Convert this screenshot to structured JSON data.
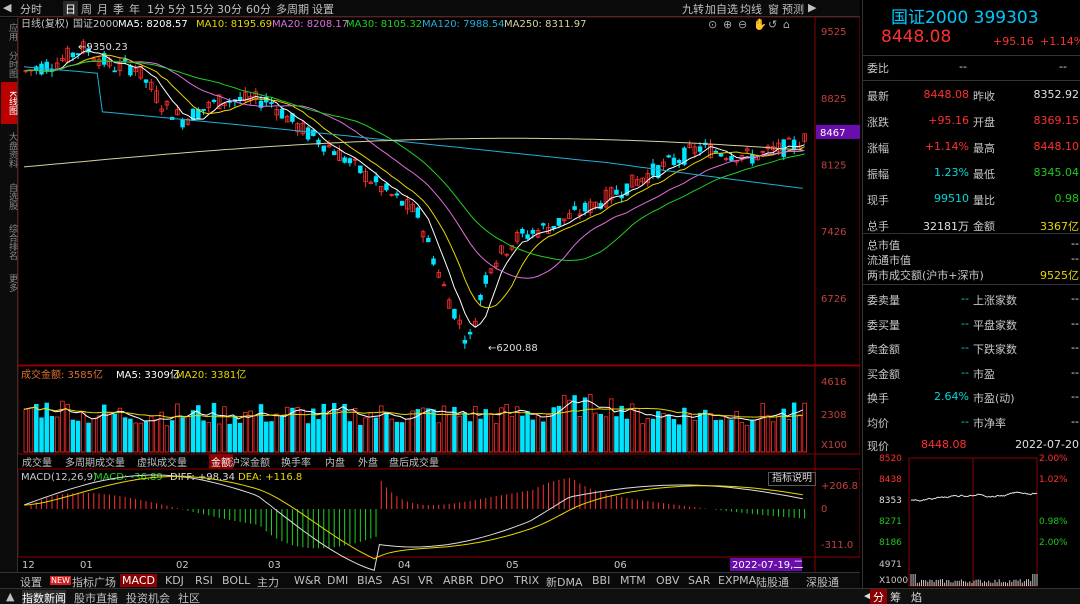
{
  "toolbar": {
    "period_tabs": [
      "分时",
      "日",
      "周",
      "月",
      "季",
      "年",
      "1分",
      "5分",
      "15分",
      "30分",
      "60分",
      "多周期",
      "设置"
    ],
    "right_tools": [
      "九转",
      "加自选",
      "均线",
      "窗",
      "预测"
    ]
  },
  "sidebar": {
    "items": [
      "应用",
      "分时图",
      "K线图",
      "大盘资料",
      "自选股",
      "综合排名",
      "更多"
    ]
  },
  "main_chart": {
    "info_label": "日线(复权)",
    "index_name": "国证2000",
    "ma5": "MA5: 8208.57",
    "ma10": "MA10: 8195.69",
    "ma20": "MA20: 8208.17",
    "ma30": "MA30: 8105.32",
    "ma120": "MA120: 7988.54",
    "ma250": "MA250: 8311.97",
    "high_label": "9350.23",
    "low_label": "6200.88",
    "price_axis": [
      "9525",
      "8825",
      "8125",
      "7426",
      "6726"
    ],
    "last_price_tag": "8467"
  },
  "volume_panel": {
    "label": "成交金额: 3585亿",
    "ma5": "MA5: 3309亿",
    "ma20": "MA20: 3381亿",
    "axis": [
      "4616",
      "2308",
      "X100"
    ]
  },
  "indicator_tabs": [
    "成交量",
    "多周期成交量",
    "虚拟成交量",
    "金额",
    "沪深金额",
    "换手率",
    "内盘",
    "外盘",
    "盘后成交量"
  ],
  "indicator_active": "金额",
  "macd_panel": {
    "label": "MACD(12,26,9)",
    "macd": "MACD: -36.89",
    "diff": "DIFF: +98.34",
    "dea": "DEA: +116.8",
    "axis": [
      "+206.8",
      "0",
      "-311.0"
    ],
    "explain_button": "指标说明"
  },
  "date_axis": [
    "12",
    "01",
    "02",
    "03",
    "04",
    "05",
    "06"
  ],
  "cursor_date": "2022-07-19,二",
  "indicator_bar": [
    "设置",
    "NEW",
    "指标广场",
    "MACD",
    "KDJ",
    "RSI",
    "BOLL",
    "主力",
    "W&R",
    "DMI",
    "BIAS",
    "ASI",
    "VR",
    "ARBR",
    "DPO",
    "TRIX",
    "新DMA",
    "BBI",
    "MTM",
    "OBV",
    "SAR",
    "EXPMA",
    "陆股通",
    "深股通"
  ],
  "status_bar": [
    "指数新闻",
    "股市直播",
    "投资机会",
    "社区"
  ],
  "quote": {
    "name": "国证2000",
    "code": "399303",
    "price": "8448.08",
    "change": "+95.16",
    "change_pct": "+1.14%",
    "weibi_label": "委比",
    "weibi_val": "--",
    "weibi_val2": "--",
    "rows": [
      {
        "l1": "最新",
        "v1": "8448.08",
        "l2": "昨收",
        "v2": "8352.92",
        "c1": "red",
        "c2": "white"
      },
      {
        "l1": "涨跌",
        "v1": "+95.16",
        "l2": "开盘",
        "v2": "8369.15",
        "c1": "red",
        "c2": "red"
      },
      {
        "l1": "涨幅",
        "v1": "+1.14%",
        "l2": "最高",
        "v2": "8448.10",
        "c1": "red",
        "c2": "red"
      },
      {
        "l1": "振幅",
        "v1": "1.23%",
        "l2": "最低",
        "v2": "8345.04",
        "c1": "cyan",
        "c2": "green"
      },
      {
        "l1": "现手",
        "v1": "99510",
        "l2": "量比",
        "v2": "0.98",
        "c1": "cyan",
        "c2": "green"
      },
      {
        "l1": "总手",
        "v1": "32181万",
        "l2": "金额",
        "v2": "3367亿",
        "c1": "white",
        "c2": "yellow"
      }
    ],
    "cap_rows": [
      {
        "l": "总市值",
        "v": "--"
      },
      {
        "l": "流通市值",
        "v": "--"
      },
      {
        "l": "两市成交额(沪市+深市)",
        "v": "9525亿"
      }
    ],
    "breadth_rows": [
      {
        "l1": "委卖量",
        "v1": "--",
        "l2": "上涨家数",
        "v2": "--"
      },
      {
        "l1": "委买量",
        "v1": "--",
        "l2": "平盘家数",
        "v2": "--"
      },
      {
        "l1": "卖金额",
        "v1": "--",
        "l2": "下跌家数",
        "v2": "--"
      },
      {
        "l1": "买金额",
        "v1": "--",
        "l2": "市盈",
        "v2": "--"
      },
      {
        "l1": "换手",
        "v1": "2.64%",
        "l2": "市盈(动)",
        "v2": "--"
      },
      {
        "l1": "均价",
        "v1": "--",
        "l2": "市净率",
        "v2": "--"
      }
    ],
    "partial_row": {
      "l": "现价",
      "v": "8448.08",
      "date": "2022-07-20"
    }
  },
  "intraday": {
    "left_axis": [
      "8520",
      "8438",
      "8353",
      "8271",
      "8186",
      "4971",
      "X1000"
    ],
    "right_axis": [
      "2.00%",
      "1.02%",
      "0.98%",
      "2.00%"
    ]
  },
  "right_tabs": [
    "分",
    "筹",
    "焰"
  ],
  "colors": {
    "up": "#ff3030",
    "down": "#00e5ff",
    "ma5": "#ffffff",
    "ma10": "#e8d600",
    "ma20": "#e070e0",
    "ma30": "#20d020",
    "ma120": "#20b0d8",
    "ma250": "#d8d0a0"
  }
}
